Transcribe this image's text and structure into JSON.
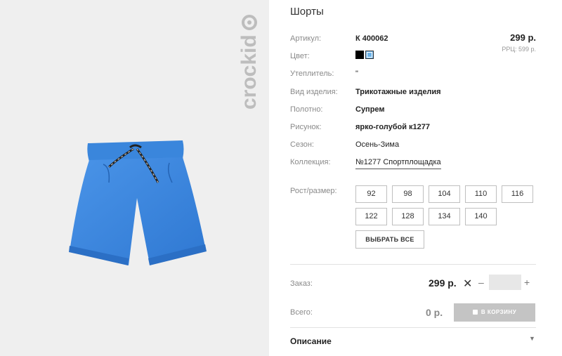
{
  "brand": {
    "logo_text": "crockid"
  },
  "product": {
    "title": "Шорты",
    "price": "299 р.",
    "rrp": "РРЦ: 599 р."
  },
  "specs": {
    "article": {
      "label": "Артикул:",
      "value": "К 400062"
    },
    "color": {
      "label": "Цвет:",
      "swatches": [
        "#000000",
        "#6db3e8"
      ]
    },
    "insulation": {
      "label": "Утеплитель:",
      "value": "\""
    },
    "type": {
      "label": "Вид изделия:",
      "value": "Трикотажные изделия"
    },
    "fabric": {
      "label": "Полотно:",
      "value": "Супрем"
    },
    "pattern": {
      "label": "Рисунок:",
      "value": "ярко-голубой к1277"
    },
    "season": {
      "label": "Сезон:",
      "value": "Осень-Зима"
    },
    "collection": {
      "label": "Коллекция:",
      "value": "№1277 Спортплощадка"
    }
  },
  "sizes": {
    "label": "Рост/размер:",
    "options": [
      "92",
      "98",
      "104",
      "110",
      "116",
      "122",
      "128",
      "134",
      "140"
    ],
    "select_all": "ВЫБРАТЬ ВСЕ"
  },
  "order": {
    "label": "Заказ:",
    "price": "299 р.",
    "times": "✕",
    "minus": "–",
    "plus": "+",
    "quantity": ""
  },
  "total": {
    "label": "Всего:",
    "value": "0 р.",
    "cart_button": "В КОРЗИНУ"
  },
  "description": {
    "label": "Описание",
    "arrow": "▼"
  },
  "colors": {
    "shorts": "#3a86dc",
    "panel_bg": "#efefef",
    "cart_disabled": "#c4c4c4"
  }
}
